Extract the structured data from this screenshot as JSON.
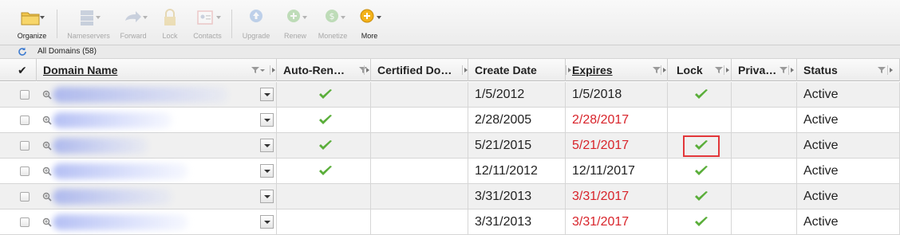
{
  "toolbar": {
    "buttons": [
      {
        "id": "organize",
        "label": "Organize",
        "icon": "folder-icon",
        "enabled": true
      },
      {
        "id": "nameservers",
        "label": "Nameservers",
        "icon": "server-icon",
        "enabled": false
      },
      {
        "id": "forward",
        "label": "Forward",
        "icon": "forward-arrow-icon",
        "enabled": false
      },
      {
        "id": "lock",
        "label": "Lock",
        "icon": "padlock-icon",
        "enabled": false
      },
      {
        "id": "contacts",
        "label": "Contacts",
        "icon": "contact-card-icon",
        "enabled": false
      },
      {
        "id": "upgrade",
        "label": "Upgrade",
        "icon": "up-arrow-circle-icon",
        "enabled": false
      },
      {
        "id": "renew",
        "label": "Renew",
        "icon": "renew-circle-icon",
        "enabled": false
      },
      {
        "id": "monetize",
        "label": "Monetize",
        "icon": "dollar-circle-icon",
        "enabled": false
      },
      {
        "id": "more",
        "label": "More",
        "icon": "plus-circle-icon",
        "enabled": true
      }
    ]
  },
  "filter_bar": {
    "label": "All Domains (58)",
    "icon": "refresh-icon"
  },
  "grid": {
    "columns": [
      {
        "id": "select",
        "label": "✔",
        "underline": false
      },
      {
        "id": "domain",
        "label": "Domain Name",
        "underline": true
      },
      {
        "id": "autorenew",
        "label": "Auto-Ren…",
        "underline": false
      },
      {
        "id": "certified",
        "label": "Certified Do…",
        "underline": false
      },
      {
        "id": "created",
        "label": "Create Date",
        "underline": false
      },
      {
        "id": "expires",
        "label": "Expires",
        "underline": true
      },
      {
        "id": "lock",
        "label": "Lock",
        "underline": false
      },
      {
        "id": "privacy",
        "label": "Priva…",
        "underline": false
      },
      {
        "id": "status",
        "label": "Status",
        "underline": false
      }
    ],
    "rows": [
      {
        "domain_hidden": true,
        "auto_renew": true,
        "create_date": "1/5/2012",
        "expires": "1/5/2018",
        "expired": false,
        "lock": true,
        "status": "Active"
      },
      {
        "domain_hidden": true,
        "auto_renew": true,
        "create_date": "2/28/2005",
        "expires": "2/28/2017",
        "expired": true,
        "lock": false,
        "status": "Active"
      },
      {
        "domain_hidden": true,
        "auto_renew": true,
        "create_date": "5/21/2015",
        "expires": "5/21/2017",
        "expired": true,
        "lock": true,
        "lock_highlighted": true,
        "status": "Active"
      },
      {
        "domain_hidden": true,
        "auto_renew": true,
        "create_date": "12/11/2012",
        "expires": "12/11/2017",
        "expired": false,
        "lock": true,
        "status": "Active"
      },
      {
        "domain_hidden": true,
        "auto_renew": false,
        "create_date": "3/31/2013",
        "expires": "3/31/2017",
        "expired": true,
        "lock": true,
        "status": "Active"
      },
      {
        "domain_hidden": true,
        "auto_renew": false,
        "create_date": "3/31/2013",
        "expires": "3/31/2017",
        "expired": true,
        "lock": true,
        "status": "Active"
      }
    ]
  },
  "colors": {
    "expired_red": "#d8232a",
    "check_green": "#5aae3a",
    "highlight_box": "#e2373a"
  }
}
